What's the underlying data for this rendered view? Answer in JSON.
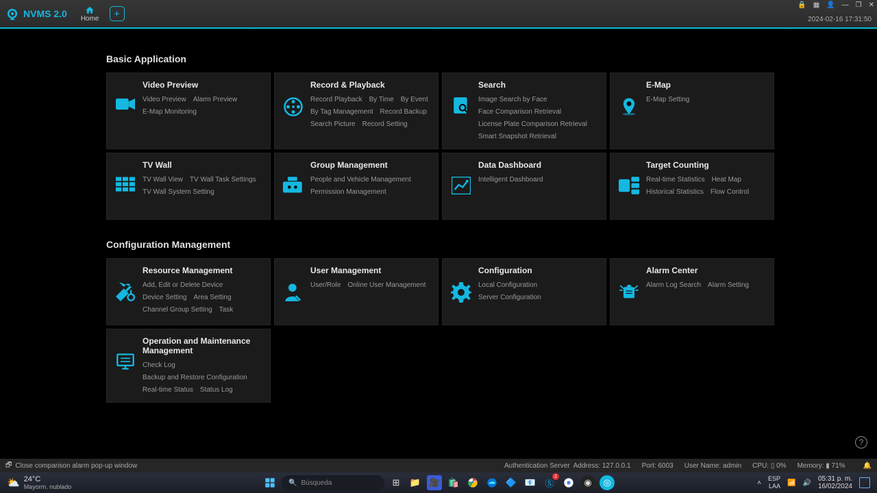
{
  "app": {
    "name": "NVMS 2.0",
    "timestamp": "2024-02-16 17:31:50"
  },
  "tabs": {
    "home": "Home"
  },
  "sections": [
    {
      "title": "Basic Application",
      "cards": [
        {
          "title": "Video Preview",
          "icon": "camera",
          "links": [
            "Video Preview",
            "Alarm Preview",
            "E-Map Monitoring"
          ]
        },
        {
          "title": "Record & Playback",
          "icon": "film",
          "links": [
            "Record Playback",
            "By Time",
            "By Event",
            "By Tag Management",
            "Record Backup",
            "Search Picture",
            "Record Setting"
          ]
        },
        {
          "title": "Search",
          "icon": "doc-search",
          "links": [
            "Image Search by Face",
            "Face Comparison Retrieval",
            "License Plate Comparison Retrieval",
            "Smart Snapshot Retrieval"
          ]
        },
        {
          "title": "E-Map",
          "icon": "map-pin",
          "links": [
            "E-Map Setting"
          ]
        },
        {
          "title": "TV Wall",
          "icon": "grid",
          "links": [
            "TV Wall View",
            "TV Wall Task Settings",
            "TV Wall System Setting"
          ]
        },
        {
          "title": "Group Management",
          "icon": "group",
          "links": [
            "People and Vehicle Management",
            "Permission Management"
          ]
        },
        {
          "title": "Data Dashboard",
          "icon": "chart",
          "links": [
            "Intelligent Dashboard"
          ]
        },
        {
          "title": "Target Counting",
          "icon": "counter",
          "links": [
            "Real-time Statistics",
            "Heat Map",
            "Historical Statistics",
            "Flow Control"
          ]
        }
      ]
    },
    {
      "title": "Configuration Management",
      "cards": [
        {
          "title": "Resource Management",
          "icon": "tools",
          "links": [
            "Add, Edit or Delete Device",
            "Device Setting",
            "Area Setting",
            "Channel Group Setting",
            "Task"
          ]
        },
        {
          "title": "User Management",
          "icon": "user",
          "links": [
            "User/Role",
            "Online User Management"
          ]
        },
        {
          "title": "Configuration",
          "icon": "gear",
          "links": [
            "Local Configuration",
            "Server Configuration"
          ]
        },
        {
          "title": "Alarm Center",
          "icon": "alarm",
          "links": [
            "Alarm Log Search",
            "Alarm Setting"
          ]
        },
        {
          "title": "Operation and Maintenance Management",
          "icon": "monitor",
          "links": [
            "Check Log",
            "Backup and Restore Configuration",
            "Real-time Status",
            "Status Log"
          ]
        }
      ]
    }
  ],
  "popup_msg": "Close comparison alarm pop-up window",
  "status": {
    "server_label": "Authentication Server",
    "addr_label": "Address:",
    "addr": "127.0.0.1",
    "port_label": "Port:",
    "port": "6003",
    "user_label": "User Name:",
    "user": "admin",
    "cpu_label": "CPU:",
    "cpu": "0%",
    "mem_label": "Memory:",
    "mem": "71%"
  },
  "taskbar": {
    "temp": "24°C",
    "cond": "Mayorm. nublado",
    "search_placeholder": "Búsqueda",
    "clock": "05:31 p. m.",
    "date": "16/02/2024"
  }
}
